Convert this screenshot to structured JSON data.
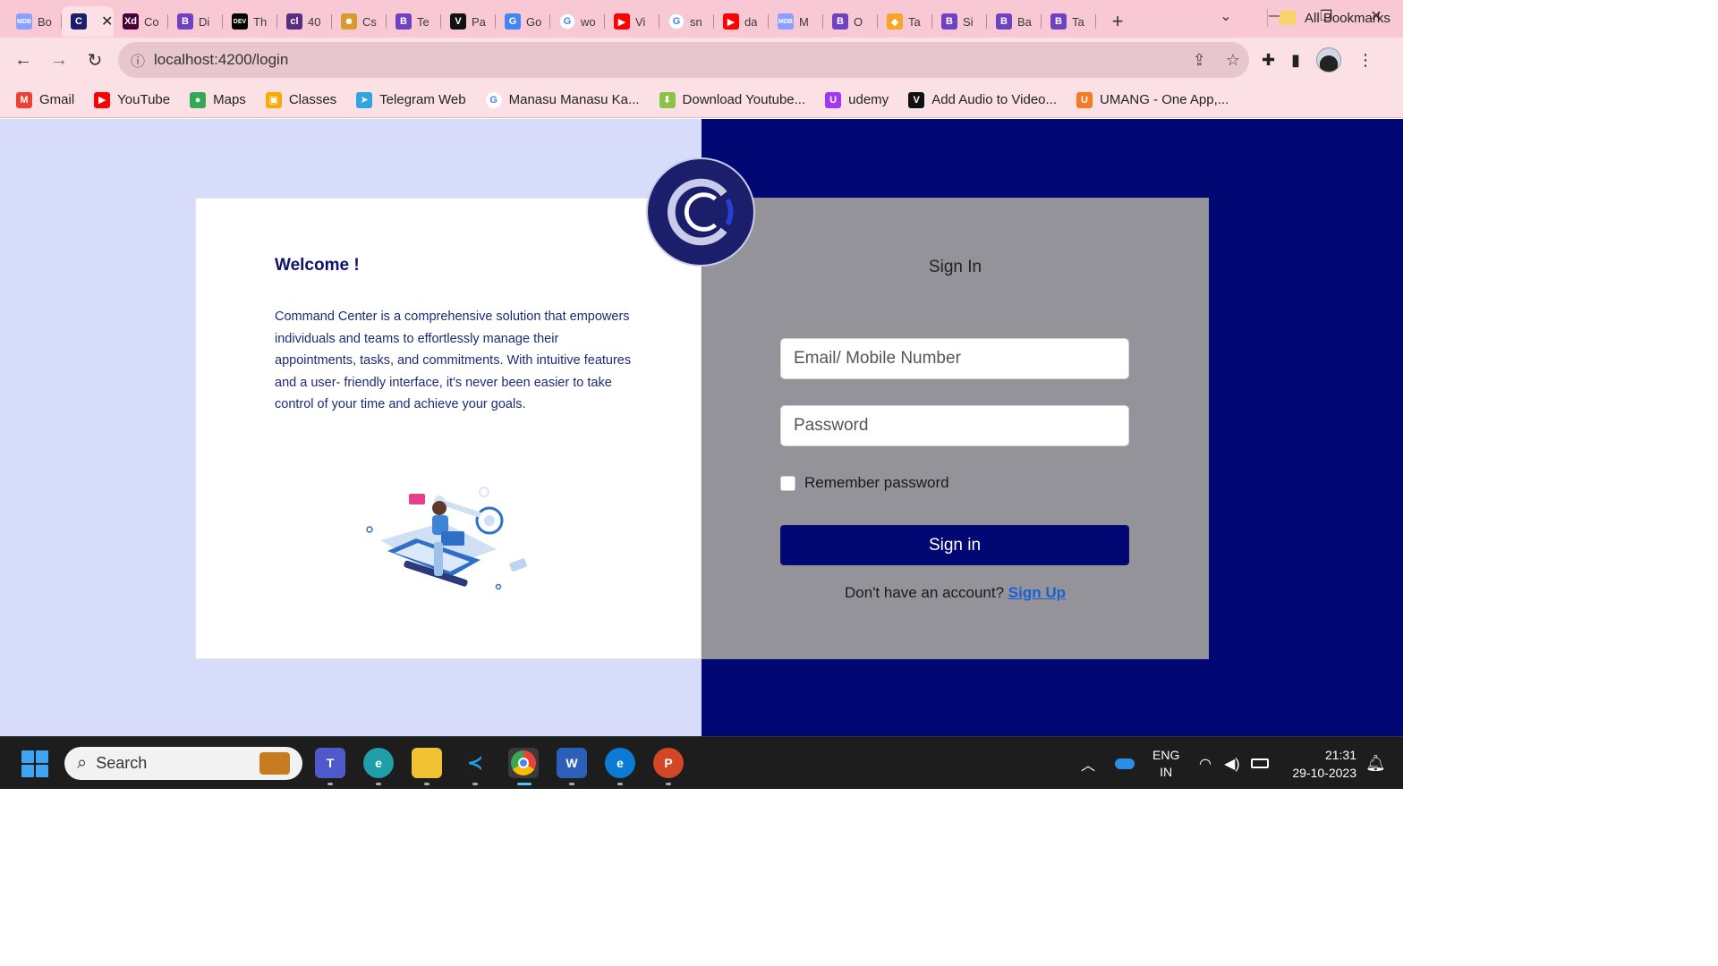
{
  "browser": {
    "tabs": [
      {
        "icon": "mdb-icon",
        "glyph": "MDB",
        "color": "#8aa0ff",
        "title": "Bo"
      },
      {
        "icon": "command-center-icon",
        "glyph": "C",
        "color": "#1b1f6b",
        "title": "",
        "active": true,
        "close": "✕"
      },
      {
        "icon": "adobe-xd-icon",
        "glyph": "Xd",
        "color": "#470137",
        "title": "Co"
      },
      {
        "icon": "bootstrap-icon",
        "glyph": "B",
        "color": "#6f42c1",
        "title": "Di"
      },
      {
        "icon": "dev-icon",
        "glyph": "DEV",
        "color": "#000000",
        "title": "Th"
      },
      {
        "icon": "colorlib-icon",
        "glyph": "cl",
        "color": "#5a2d82",
        "title": "40"
      },
      {
        "icon": "person-icon",
        "glyph": "☻",
        "color": "#d69a2d",
        "title": "Cs"
      },
      {
        "icon": "bootstrap-icon",
        "glyph": "B",
        "color": "#6f42c1",
        "title": "Te"
      },
      {
        "icon": "v-icon",
        "glyph": "V",
        "color": "#111111",
        "title": "Pa"
      },
      {
        "icon": "google-translate-icon",
        "glyph": "G",
        "color": "#4285f4",
        "title": "Go"
      },
      {
        "icon": "google-icon",
        "glyph": "G",
        "color": "#ffffff",
        "title": "wo"
      },
      {
        "icon": "youtube-icon",
        "glyph": "▶",
        "color": "#ff0000",
        "title": "Vi"
      },
      {
        "icon": "google-icon",
        "glyph": "G",
        "color": "#ffffff",
        "title": "sn"
      },
      {
        "icon": "youtube-icon",
        "glyph": "▶",
        "color": "#ff0000",
        "title": "da"
      },
      {
        "icon": "mdb-icon",
        "glyph": "MDB",
        "color": "#8aa0ff",
        "title": "M"
      },
      {
        "icon": "bootstrap-icon",
        "glyph": "B",
        "color": "#6f42c1",
        "title": "O"
      },
      {
        "icon": "brave-icon",
        "glyph": "◆",
        "color": "#f5a623",
        "title": "Ta"
      },
      {
        "icon": "bootstrap-icon",
        "glyph": "B",
        "color": "#6f42c1",
        "title": "Si"
      },
      {
        "icon": "bootstrap-icon",
        "glyph": "B",
        "color": "#6f42c1",
        "title": "Ba"
      },
      {
        "icon": "bootstrap-icon",
        "glyph": "B",
        "color": "#6f42c1",
        "title": "Ta"
      }
    ],
    "new_tab": "+",
    "url": "localhost:4200/login",
    "bookmarks": [
      {
        "icon": "gmail-icon",
        "glyph": "M",
        "color": "#ea4335",
        "label": "Gmail"
      },
      {
        "icon": "youtube-icon",
        "glyph": "▶",
        "color": "#ff0000",
        "label": "YouTube"
      },
      {
        "icon": "maps-icon",
        "glyph": "●",
        "color": "#34a853",
        "label": "Maps"
      },
      {
        "icon": "classroom-icon",
        "glyph": "▣",
        "color": "#f9ab00",
        "label": "Classes"
      },
      {
        "icon": "telegram-icon",
        "glyph": "➤",
        "color": "#2ca5e0",
        "label": "Telegram Web"
      },
      {
        "icon": "google-icon",
        "glyph": "G",
        "color": "#ffffff",
        "label": "Manasu Manasu Ka..."
      },
      {
        "icon": "download-icon",
        "glyph": "⬇",
        "color": "#8bc34a",
        "label": "Download Youtube..."
      },
      {
        "icon": "udemy-icon",
        "glyph": "U",
        "color": "#a435f0",
        "label": "udemy"
      },
      {
        "icon": "v-icon",
        "glyph": "V",
        "color": "#111111",
        "label": "Add Audio to Video..."
      },
      {
        "icon": "umang-icon",
        "glyph": "U",
        "color": "#f47b20",
        "label": "UMANG - One App,..."
      }
    ],
    "all_bookmarks": "All Bookmarks"
  },
  "welcome": {
    "heading": "Welcome !",
    "description": "Command Center is a comprehensive solution that empowers individuals and teams to effortlessly manage their appointments, tasks, and commitments. With intuitive features and a user- friendly interface, it's never been easier to take control of your time and achieve your goals."
  },
  "signin": {
    "title": "Sign In",
    "email_placeholder": "Email/ Mobile Number",
    "password_placeholder": "Password",
    "remember_label": "Remember password",
    "button_label": "Sign in",
    "no_account_text": "Don't have an account?",
    "signup_link": "Sign Up"
  },
  "taskbar": {
    "search_placeholder": "Search",
    "lang_top": "ENG",
    "lang_bottom": "IN",
    "time": "21:31",
    "date": "29-10-2023"
  },
  "colors": {
    "left_bg": "#d7dcfa",
    "right_bg": "#020873",
    "form_panel": "#939399",
    "brand": "#1b1f6b",
    "link": "#1a5fd6"
  }
}
